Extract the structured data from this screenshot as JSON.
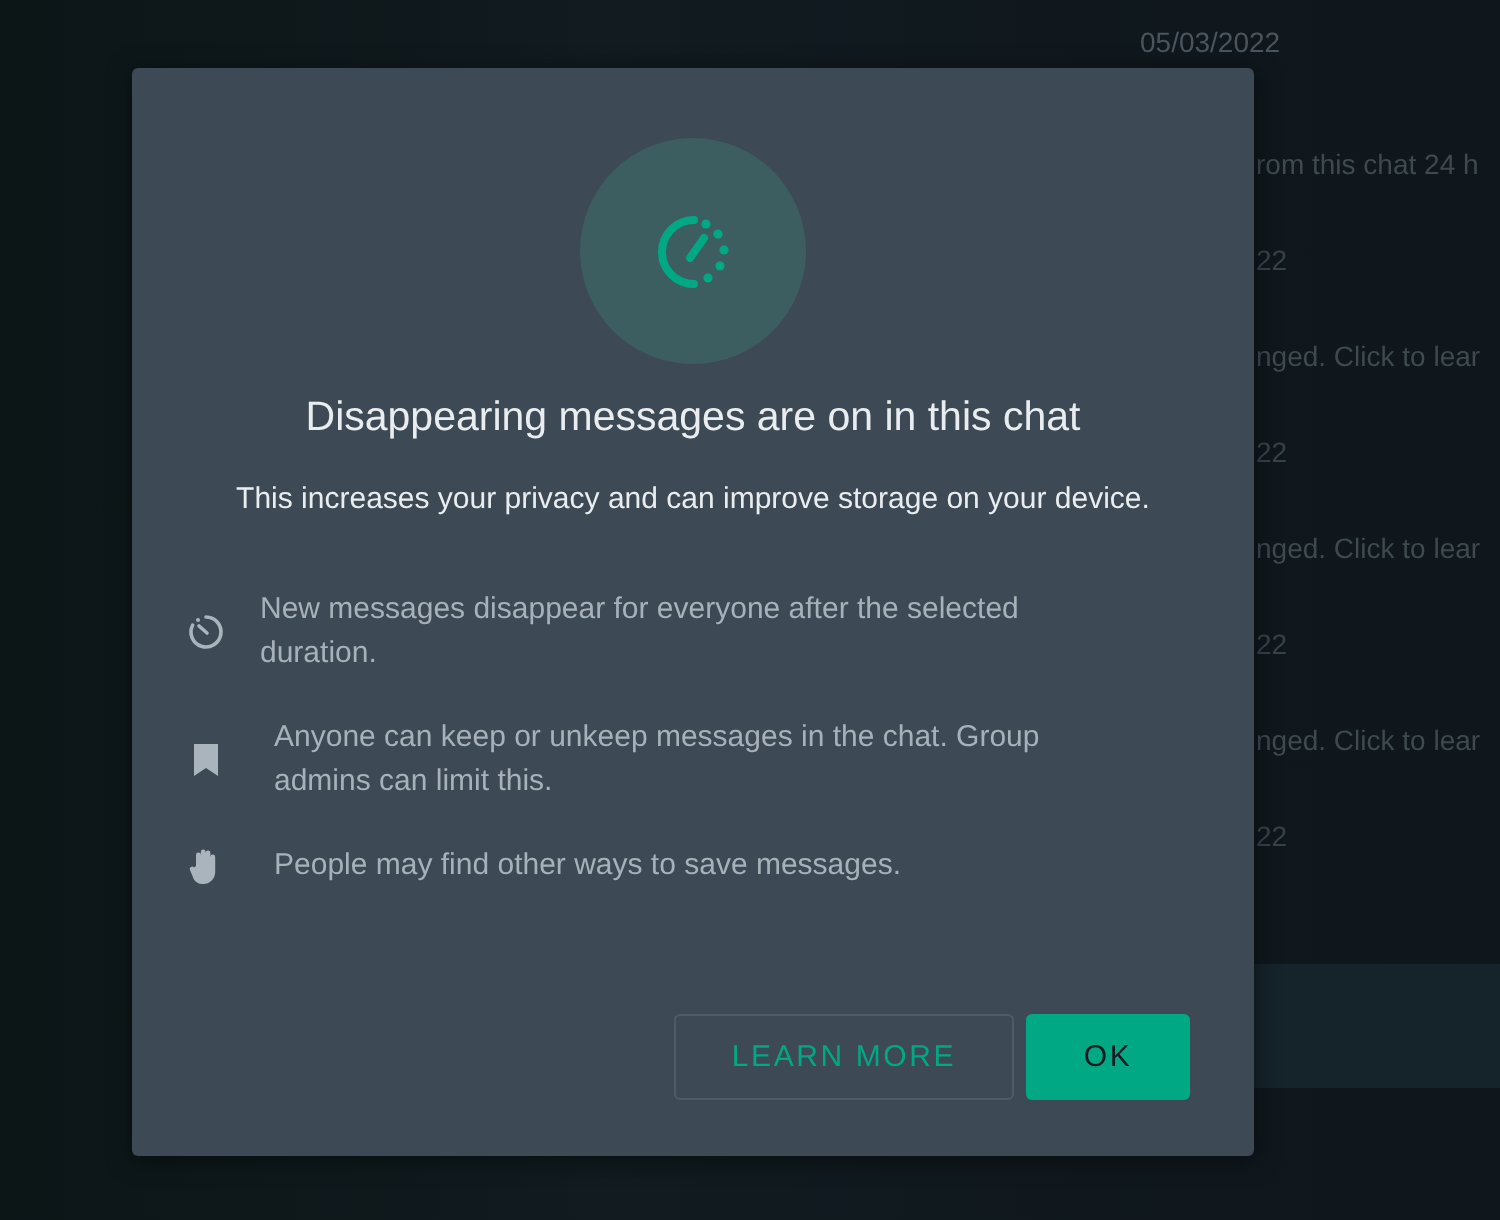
{
  "background_chat": {
    "top_date": "05/03/2022",
    "rows": [
      {
        "kind": "message",
        "text": "rom this chat 24 h"
      },
      {
        "kind": "date",
        "text": "22"
      },
      {
        "kind": "message",
        "text": "nged. Click to lear"
      },
      {
        "kind": "date",
        "text": "22"
      },
      {
        "kind": "message",
        "text": "nged. Click to lear"
      },
      {
        "kind": "date",
        "text": "22"
      },
      {
        "kind": "message",
        "text": "nged. Click to lear"
      },
      {
        "kind": "date",
        "text": "22"
      }
    ]
  },
  "dialog": {
    "title": "Disappearing messages are on in this chat",
    "subtitle": "This increases your privacy and can improve storage on your device.",
    "points": [
      {
        "kind": "timer",
        "text": "New messages disappear for everyone after the selected duration."
      },
      {
        "kind": "bookmark",
        "text": "Anyone can keep or unkeep messages in the chat. Group admins can limit this."
      },
      {
        "kind": "hand",
        "text": "People may find other ways to save messages."
      }
    ],
    "buttons": [
      {
        "kind": "secondary",
        "label": "LEARN MORE"
      },
      {
        "kind": "primary",
        "label": "OK"
      }
    ]
  }
}
